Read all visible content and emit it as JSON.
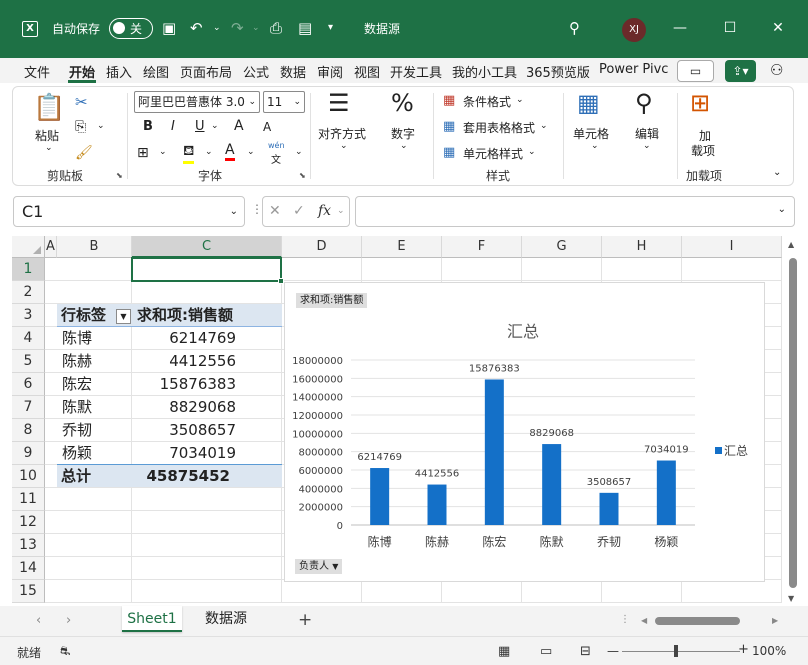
{
  "titlebar": {
    "app_icon": "excel-icon",
    "autosave_label": "自动保存",
    "autosave_state": "关",
    "document_title": "数据源",
    "avatar_initials": "XJ",
    "bg_color": "#1e7145"
  },
  "ribbon_tabs": [
    "文件",
    "开始",
    "插入",
    "绘图",
    "页面布局",
    "公式",
    "数据",
    "审阅",
    "视图",
    "开发工具",
    "我的小工具",
    "365预览版",
    "Power Pivc"
  ],
  "active_tab": "开始",
  "ribbon": {
    "clipboard": {
      "paste": "粘贴",
      "group": "剪贴板"
    },
    "font": {
      "font_name": "阿里巴巴普惠体 3.0",
      "font_size": "11",
      "bold": "B",
      "italic": "I",
      "underline": "U",
      "grow": "A",
      "shrink": "A",
      "group": "字体",
      "phonetic": "wén",
      "phonetic_zh": "文"
    },
    "alignment": {
      "label": "对齐方式"
    },
    "number": {
      "label": "数字"
    },
    "styles": {
      "conditional": "条件格式",
      "table": "套用表格格式",
      "cell_style": "单元格样式",
      "group": "样式"
    },
    "cells": {
      "label": "单元格"
    },
    "editing": {
      "label": "编辑"
    },
    "addins": {
      "label1": "加",
      "label2": "载项",
      "group": "加载项"
    }
  },
  "formula_bar": {
    "name_box": "C1",
    "fx": "fx",
    "formula": ""
  },
  "columns": [
    "A",
    "B",
    "C",
    "D",
    "E",
    "F",
    "G",
    "H",
    "I"
  ],
  "selected_column": "C",
  "rows": [
    "1",
    "2",
    "3",
    "4",
    "5",
    "6",
    "7",
    "8",
    "9",
    "10",
    "11",
    "12",
    "13",
    "14",
    "15"
  ],
  "selected_row": "1",
  "pivot": {
    "header_label": "行标签",
    "header_value": "求和项:销售额",
    "rows": [
      {
        "name": "陈博",
        "value": "6214769"
      },
      {
        "name": "陈赫",
        "value": "4412556"
      },
      {
        "name": "陈宏",
        "value": "15876383"
      },
      {
        "name": "陈默",
        "value": "8829068"
      },
      {
        "name": "乔韧",
        "value": "3508657"
      },
      {
        "name": "杨颖",
        "value": "7034019"
      }
    ],
    "total_label": "总计",
    "total_value": "45875452"
  },
  "chart_data": {
    "type": "bar",
    "title": "汇总",
    "field_button_value": "求和项:销售额",
    "field_button_axis": "负责人",
    "categories": [
      "陈博",
      "陈赫",
      "陈宏",
      "陈默",
      "乔韧",
      "杨颖"
    ],
    "series": [
      {
        "name": "汇总",
        "values": [
          6214769,
          4412556,
          15876383,
          8829068,
          3508657,
          7034019
        ],
        "color": "#1470c8"
      }
    ],
    "ylim": [
      0,
      18000000
    ],
    "yticks": [
      "0",
      "2000000",
      "4000000",
      "6000000",
      "8000000",
      "10000000",
      "12000000",
      "14000000",
      "16000000",
      "18000000"
    ],
    "legend": "right",
    "grid": true,
    "data_labels": true
  },
  "sheets": [
    "Sheet1",
    "数据源"
  ],
  "active_sheet": "Sheet1",
  "status": {
    "ready": "就绪",
    "zoom": "100%"
  }
}
